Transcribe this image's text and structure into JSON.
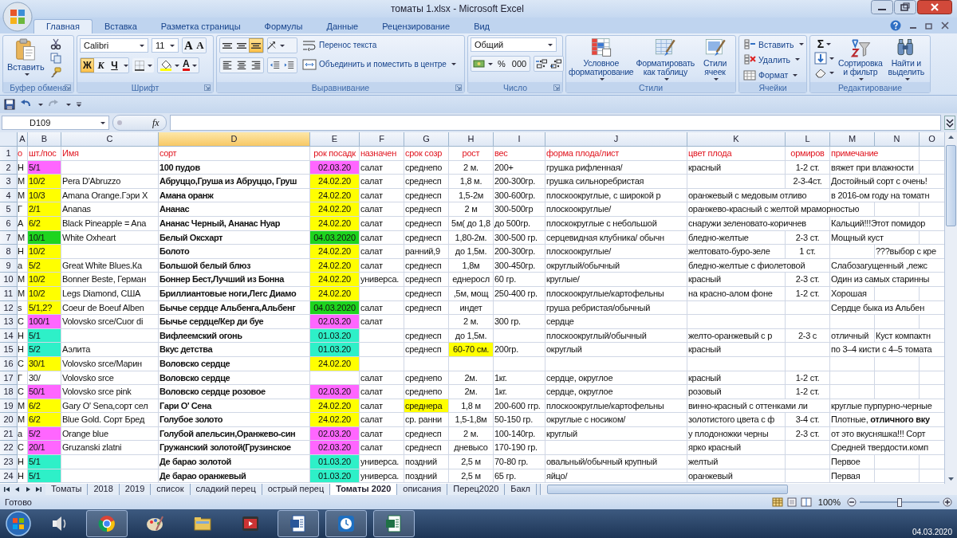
{
  "window": {
    "title": "томаты 1.xlsx - Microsoft Excel"
  },
  "tabs": [
    {
      "label": "Главная",
      "selected": true
    },
    {
      "label": "Вставка",
      "selected": false
    },
    {
      "label": "Разметка страницы",
      "selected": false
    },
    {
      "label": "Формулы",
      "selected": false
    },
    {
      "label": "Данные",
      "selected": false
    },
    {
      "label": "Рецензирование",
      "selected": false
    },
    {
      "label": "Вид",
      "selected": false
    }
  ],
  "ribbon": {
    "clipboard": {
      "title": "Буфер обмена",
      "paste_label": "Вставить"
    },
    "font": {
      "title": "Шрифт",
      "font_name": "Calibri",
      "font_size": "11",
      "grow_label": "A",
      "shrink_label": "A",
      "color_label": "A",
      "style_buttons": [
        {
          "label": "Ж",
          "selected": true
        },
        {
          "label": "К",
          "selected": false
        },
        {
          "label": "Ч",
          "selected": false
        }
      ]
    },
    "alignment": {
      "title": "Выравнивание",
      "vertical_align": [
        {
          "selected": false
        },
        {
          "selected": false
        },
        {
          "selected": true
        }
      ],
      "wrap_label": "Перенос текста",
      "merge_label": "Объединить и поместить в центре"
    },
    "number": {
      "title": "Число",
      "format": "Общий",
      "percent_label": "%",
      "thousands_label": "000"
    },
    "styles": {
      "title": "Стили",
      "buttons": [
        "Условное\nформатирование",
        "Форматировать\nкак таблицу",
        "Стили\nячеек"
      ]
    },
    "cells": {
      "title": "Ячейки",
      "buttons": [
        "Вставить",
        "Удалить",
        "Формат"
      ]
    },
    "editing": {
      "title": "Редактирование",
      "sum_label": "Σ",
      "buttons": [
        "Сортировка\nи фильтр",
        "Найти и\nвыделить"
      ]
    }
  },
  "formula_bar": {
    "name_box": "D109",
    "function_label": "fx"
  },
  "sheet": {
    "columns": [
      {
        "letter": "A",
        "selected": false
      },
      {
        "letter": "B",
        "selected": false
      },
      {
        "letter": "C",
        "selected": false
      },
      {
        "letter": "D",
        "selected": true
      },
      {
        "letter": "E",
        "selected": false
      },
      {
        "letter": "F",
        "selected": false
      },
      {
        "letter": "G",
        "selected": false
      },
      {
        "letter": "H",
        "selected": false
      },
      {
        "letter": "I",
        "selected": false
      },
      {
        "letter": "J",
        "selected": false
      },
      {
        "letter": "K",
        "selected": false
      },
      {
        "letter": "L",
        "selected": false
      },
      {
        "letter": "M",
        "selected": false
      },
      {
        "letter": "N",
        "selected": false
      },
      {
        "letter": "O",
        "selected": false
      }
    ],
    "rows": [
      {
        "number": "1",
        "kind": "header",
        "cells": [
          "о",
          "шт./пос",
          "Имя",
          "сорт",
          "рок посадк",
          "назначен",
          "срок созр",
          "рост",
          "вес",
          "форма плода/лист",
          "цвет плода",
          "ормиров",
          "примечание",
          null
        ]
      },
      {
        "number": "2",
        "kind": "data",
        "cells": [
          "Н",
          {
            "text": "5/1",
            "color": "#ff66ff"
          },
          null,
          "100 пудов",
          {
            "text": "02.03.20",
            "color": "#ff66ff"
          },
          "салат",
          "среднепо",
          "2 м.",
          "200+",
          "грушка рифленная/",
          "красный",
          "1-2 ст.",
          "вяжет при влажности",
          null
        ]
      },
      {
        "number": "3",
        "kind": "data",
        "cells": [
          "М",
          {
            "text": "10/2",
            "color": "#ffff00"
          },
          "Pera D'Abruzzo",
          "Абруццо,Груша из Абруццо, Груш",
          {
            "text": "24.02.20",
            "color": "#ffff00"
          },
          "салат",
          "среднесп",
          "1,8 м.",
          "200-300гр.",
          "грушка сильноребристая",
          null,
          "2-3-4ст.",
          "Достойный сорт с очень!",
          null
        ]
      },
      {
        "number": "4",
        "kind": "data",
        "cells": [
          "М",
          {
            "text": "10/3",
            "color": "#ffff00"
          },
          "Amana Orange.Гэри Х",
          "Амана оранж",
          {
            "text": "24.02.20",
            "color": "#ffff00"
          },
          "салат",
          "среднесп",
          "1,5-2м",
          "300-600гр.",
          "плоскоокруглые, с широкой р",
          "оранжевый с медовым отливо",
          null,
          "в 2016-ом году на томатн",
          null
        ]
      },
      {
        "number": "5",
        "kind": "data",
        "cells": [
          "Г",
          {
            "text": "2/1",
            "color": "#ffff00"
          },
          "Ananas",
          "Ананас",
          {
            "text": "24.02.20",
            "color": "#ffff00"
          },
          "салат",
          "среднесп",
          "2 м",
          "300-500гр",
          "плоскоокруглые/",
          "оранжево-красный с желтой мраморностью",
          null,
          null,
          null
        ]
      },
      {
        "number": "6",
        "kind": "data",
        "cells": [
          "А",
          {
            "text": "6/2",
            "color": "#ffff00"
          },
          "Black Pineapple = Ana",
          "Ананас Черный, Ананас Нуар",
          {
            "text": "24.02.20",
            "color": "#ffff00"
          },
          "салат",
          "среднесп",
          "5м( до 1,8",
          "до 500гр.",
          "плоскокруглые с небольшой",
          "снаружи зеленовато-коричнев",
          null,
          "Кальций!!!Этот помидор",
          null
        ]
      },
      {
        "number": "7",
        "kind": "data",
        "cells": [
          "М",
          {
            "text": "10/1",
            "color": "#1ed41e"
          },
          "White Oxheart",
          "Белый Оксхарт",
          {
            "text": "04.03.2020",
            "color": "#1ed41e"
          },
          "салат",
          "среднесп",
          "1,80-2м.",
          "300-500 гр.",
          "серцевидная клубника/ обычн",
          "бледно-желтые",
          "2-3 ст.",
          "Мощный куст",
          null
        ]
      },
      {
        "number": "8",
        "kind": "data",
        "cells": [
          "Н",
          {
            "text": "10/2",
            "color": "#ffff00"
          },
          null,
          "Болото",
          {
            "text": "24.02.20",
            "color": "#ffff00"
          },
          "салат",
          "ранний,9",
          "до 1,5м.",
          "200-300гр.",
          "плоскоокруглые/",
          "желтовато-буро-зеле",
          "1 ст.",
          null,
          "???выбор с кре"
        ]
      },
      {
        "number": "9",
        "kind": "data",
        "cells": [
          "a",
          {
            "text": "5/2",
            "color": "#ffff00"
          },
          "Great White Blues.Ка",
          "Большой белый блюз",
          {
            "text": "24.02.20",
            "color": "#ffff00"
          },
          "салат",
          "среднесп",
          "1,8м",
          "300-450гр.",
          "округлый/обычный",
          "бледно-желтые с фиолетовой",
          null,
          "Слабозагущенный ,лежс",
          null
        ]
      },
      {
        "number": "10",
        "kind": "data",
        "cells": [
          "М",
          {
            "text": "10/2",
            "color": "#ffff00"
          },
          "Bonner Beste, Герман",
          "Боннер Бест,Лучший из Бонна",
          {
            "text": "24.02.20",
            "color": "#ffff00"
          },
          "универса.",
          "среднесп",
          "еднеросл",
          "60 гр.",
          "круглые/",
          "красный",
          "2-3 ст.",
          "Один из самых старинны",
          null
        ]
      },
      {
        "number": "11",
        "kind": "data",
        "cells": [
          "М",
          {
            "text": "10/2",
            "color": "#ffff00"
          },
          "Legs Diamond, США",
          "Бриллиантовые ноги,Легс Диамо",
          {
            "text": "24.02.20",
            "color": "#ffff00"
          },
          null,
          "среднесп",
          ",5м, мощ",
          "250-400 гр.",
          "плоскоокруглые/картофельны",
          "на красно-алом фоне",
          "1-2 ст.",
          "Хорошая",
          null
        ]
      },
      {
        "number": "12",
        "kind": "data",
        "cells": [
          "s",
          {
            "text": "5/1,2?",
            "color": "#ffff00"
          },
          "Coeur de Boeuf Alben",
          "Бычье сердце Альбенга,Альбенг",
          {
            "text": "04.03.2020",
            "color": "#1ed41e"
          },
          "салат",
          "среднесп",
          "индет",
          null,
          "груша ребристая/обычный",
          null,
          null,
          "Сердце быка из Альбен",
          null
        ]
      },
      {
        "number": "13",
        "kind": "data",
        "cells": [
          "С",
          {
            "text": "100/1",
            "color": "#ff66ff"
          },
          "Volovsko srce/Cuor di",
          "Бычье сердце/Кер ди буе",
          {
            "text": "02.03.20",
            "color": "#ff66ff"
          },
          "салат",
          null,
          "2 м.",
          "300 гр.",
          "сердце",
          null,
          null,
          null,
          null
        ]
      },
      {
        "number": "14",
        "kind": "data",
        "cells": [
          "Н",
          {
            "text": "5/1",
            "color": "#2ef0c8"
          },
          null,
          "Вифлеемский огонь",
          {
            "text": "01.03.20",
            "color": "#2ef0c8"
          },
          null,
          "среднесп",
          "до 1,5м.",
          null,
          "плоскоокруглый/обычный",
          "желто-оранжевый с р",
          "2-3 с",
          "отличный",
          "Куст компактн"
        ]
      },
      {
        "number": "15",
        "kind": "data",
        "cells": [
          "Н",
          {
            "text": "5/2",
            "color": "#2ef0c8"
          },
          "Аэлита",
          "Вкус детства",
          {
            "text": "01.03.20",
            "color": "#2ef0c8"
          },
          null,
          "среднесп",
          {
            "text": "60-70 см.",
            "color": "#ffff00"
          },
          "200гр.",
          "округлый",
          "красный",
          null,
          "по 3–4 кисти с 4–5 томата",
          null
        ]
      },
      {
        "number": "16",
        "kind": "data",
        "cells": [
          "С",
          {
            "text": "30/1",
            "color": "#ffff00"
          },
          "Volovsko srce/Марин",
          "Воловско сердце",
          {
            "text": "24.02.20",
            "color": "#ffff00"
          },
          null,
          null,
          null,
          null,
          null,
          null,
          null,
          null,
          null
        ]
      },
      {
        "number": "17",
        "kind": "data",
        "cells": [
          "Г",
          "30/",
          "Volovsko srce",
          "Воловско сердце",
          null,
          "салат",
          "среднепо",
          "2м.",
          "1кг.",
          "сердце, округлое",
          "красный",
          "1-2 ст.",
          null,
          null
        ]
      },
      {
        "number": "18",
        "kind": "data",
        "cells": [
          "С",
          {
            "text": "50/1",
            "color": "#ff66ff"
          },
          "Volovsko srce pink",
          "Воловско сердце розовое",
          {
            "text": "02.03.20",
            "color": "#ff66ff"
          },
          "салат",
          "среднепо",
          "2м.",
          "1кг.",
          "сердце, округлое",
          "розовый",
          "1-2 ст.",
          null,
          null
        ]
      },
      {
        "number": "19",
        "kind": "data",
        "cells": [
          "М",
          {
            "text": "6/2",
            "color": "#ffff00"
          },
          "Gary O' Sena,сорт сел",
          "Гари О' Сена",
          {
            "text": "24.02.20",
            "color": "#ffff00"
          },
          "салат",
          {
            "text": "среднера",
            "color": "#ffff00"
          },
          "1,8 м",
          "200-600 ггр.",
          "плоскоокруглые/картофельны",
          "винно-красный с оттенками ли",
          null,
          "круглые пурпурно-черные",
          null
        ]
      },
      {
        "number": "20",
        "kind": "data",
        "cells": [
          "М",
          {
            "text": "6/2",
            "color": "#ffff00"
          },
          "Blue Gold. Сорт Бред",
          "Голубое золото",
          {
            "text": "24.02.20",
            "color": "#ffff00"
          },
          "салат",
          "ср. ранни",
          "1,5-1,8м",
          "50-150 гр.",
          "округлые с носиком/",
          "золотистого цвета с ф",
          "3-4 ст.",
          "Плотные, **отличного вку**",
          null
        ]
      },
      {
        "number": "21",
        "kind": "data",
        "cells": [
          "a",
          {
            "text": "5/2",
            "color": "#ff66ff"
          },
          "Orange blue",
          "Голубой апельсин,Оранжево-син",
          {
            "text": "02.03.20",
            "color": "#ff66ff"
          },
          "салат",
          "среднесп",
          "2 м.",
          "100-140гр.",
          "круглый",
          "у плодоножки черны",
          "2-3 ст.",
          "от это вкусняшка!!!  Сорт",
          null
        ]
      },
      {
        "number": "22",
        "kind": "data",
        "cells": [
          "С",
          {
            "text": "20/1",
            "color": "#ff66ff"
          },
          "Gruzanski zlatni",
          "Гружанский золотой(Грузинское",
          {
            "text": "02.03.20",
            "color": "#ff66ff"
          },
          "салат",
          "среднесп",
          "дневысо",
          "170-190 гр.",
          null,
          "ярко красный",
          null,
          "Средней твердости.комп",
          null
        ]
      },
      {
        "number": "23",
        "kind": "data",
        "cells": [
          "Н",
          {
            "text": "5/1",
            "color": "#2ef0c8"
          },
          null,
          "Де барао золотой",
          {
            "text": "01.03.20",
            "color": "#2ef0c8"
          },
          "универса.",
          "поздний",
          "2,5 м",
          "70-80 гр.",
          "овальный/обычный крупный",
          "желтый",
          null,
          "Первое",
          null
        ]
      },
      {
        "number": "24",
        "kind": "data",
        "cells": [
          "Н",
          {
            "text": "5/1",
            "color": "#2ef0c8"
          },
          null,
          "Де барао оранжевый",
          {
            "text": "01.03.20",
            "color": "#2ef0c8"
          },
          "универса.",
          "поздний",
          "2,5 м",
          "65 гр.",
          "яйцо/",
          "оранжевый",
          null,
          "Первая",
          null
        ]
      }
    ]
  },
  "sheet_tabs": [
    {
      "label": "Томаты",
      "selected": false
    },
    {
      "label": "2018",
      "selected": false
    },
    {
      "label": "2019",
      "selected": false
    },
    {
      "label": "список",
      "selected": false
    },
    {
      "label": "сладкий перец",
      "selected": false
    },
    {
      "label": "острый перец",
      "selected": false
    },
    {
      "label": "Томаты 2020",
      "selected": true
    },
    {
      "label": "описания",
      "selected": false
    },
    {
      "label": "Перец2020",
      "selected": false
    },
    {
      "label": "Бакл",
      "selected": false
    }
  ],
  "status_bar": {
    "status": "Готово",
    "zoom_label": "100%",
    "level": 0.5
  },
  "taskbar": {
    "apps": [
      {
        "running": false
      },
      {
        "running": true
      },
      {
        "running": false
      },
      {
        "running": false
      },
      {
        "running": false
      },
      {
        "running": true
      },
      {
        "running": true
      },
      {
        "running": true
      }
    ],
    "date": "04.03.2020"
  }
}
